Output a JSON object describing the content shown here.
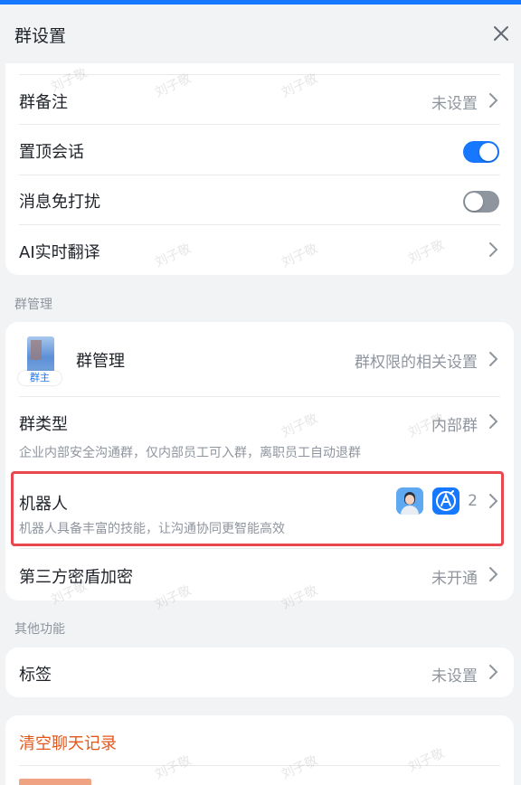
{
  "header": {
    "title": "群设置",
    "close_icon": "close-icon"
  },
  "settings": {
    "group_remark": {
      "label": "群备注",
      "value": "未设置"
    },
    "pin_chat": {
      "label": "置顶会话",
      "enabled": true
    },
    "do_not_disturb": {
      "label": "消息免打扰",
      "enabled": false
    },
    "ai_translate": {
      "label": "AI实时翻译"
    }
  },
  "group_management": {
    "section_label": "群管理",
    "manage": {
      "label": "群管理",
      "value": "群权限的相关设置",
      "avatar_badge": "群主"
    },
    "group_type": {
      "label": "群类型",
      "value": "内部群",
      "desc": "企业内部安全沟通群，仅内部员工可入群，离职员工自动退群"
    },
    "bots": {
      "label": "机器人",
      "count": "2",
      "desc": "机器人具备丰富的技能，让沟通协同更智能高效"
    },
    "encryption": {
      "label": "第三方密盾加密",
      "value": "未开通"
    }
  },
  "other": {
    "section_label": "其他功能",
    "tags": {
      "label": "标签",
      "value": "未设置"
    }
  },
  "danger": {
    "clear_history": "清空聊天记录"
  },
  "watermark_text": "刘子敬",
  "colors": {
    "accent": "#1677ff",
    "danger": "#e4571b",
    "highlight": "#e8474d"
  }
}
